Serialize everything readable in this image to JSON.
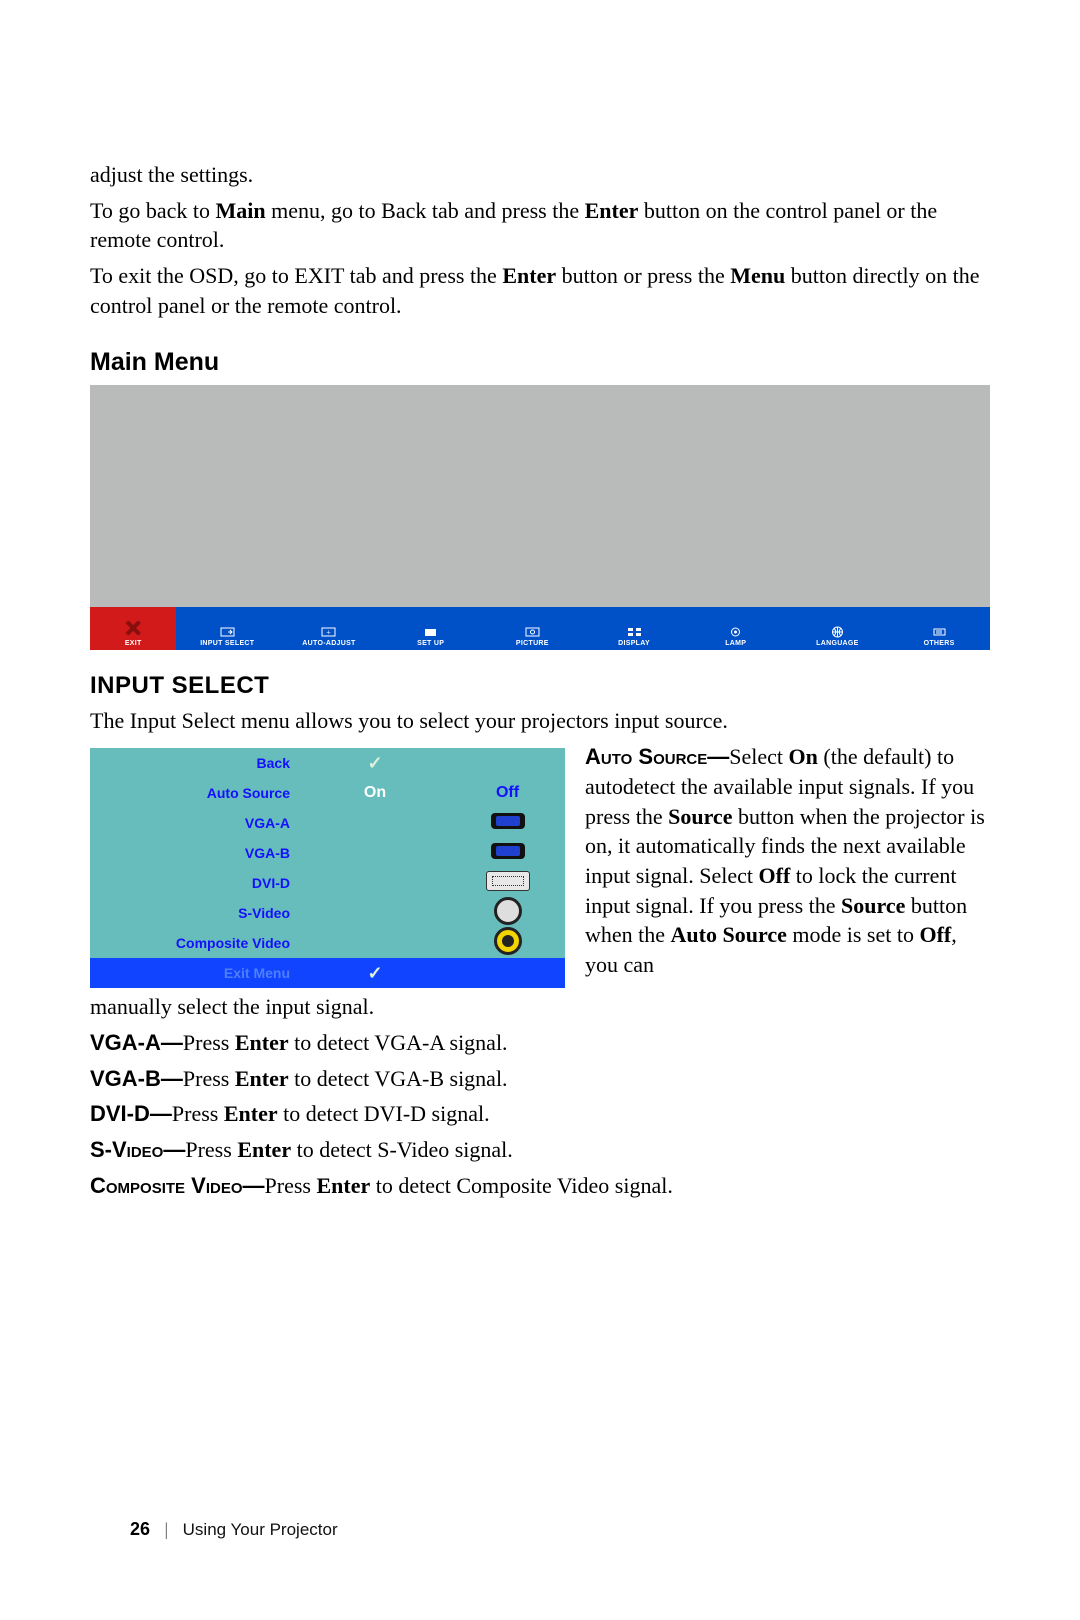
{
  "intro": {
    "p1": "adjust the settings.",
    "p2a": "To go back to ",
    "p2b": "Main",
    "p2c": " menu, go to Back tab and press the ",
    "p2d": "Enter",
    "p2e": " button on the control panel or the remote control.",
    "p3a": "To exit the OSD, go to EXIT tab and press the ",
    "p3b": "Enter",
    "p3c": " button or press the ",
    "p3d": "Menu",
    "p3e": " button directly on the control panel or the remote control."
  },
  "headings": {
    "main_menu": "Main Menu",
    "input_select": "INPUT SELECT"
  },
  "mainmenu_tabs": {
    "exit": "EXIT",
    "input_select": "INPUT SELECT",
    "auto_adjust": "AUTO-ADJUST",
    "set_up": "SET UP",
    "picture": "PICTURE",
    "display": "DISPLAY",
    "lamp": "LAMP",
    "language": "LANGUAGE",
    "others": "OTHERS"
  },
  "input_select_section": {
    "intro": "The Input Select menu allows you to select your projectors input source.",
    "menu": {
      "back": "Back",
      "auto_source": "Auto Source",
      "on": "On",
      "off": "Off",
      "vga_a": "VGA-A",
      "vga_b": "VGA-B",
      "dvi_d": "DVI-D",
      "s_video": "S-Video",
      "composite": "Composite Video",
      "exit_menu": "Exit Menu"
    },
    "auto_source_desc": {
      "label": "Auto Source—",
      "t1": "Select ",
      "b1": "On",
      "t2": " (the default) to autodetect the available input signals. If you press the ",
      "b2": "Source",
      "t3": " button when the projector is on, it automatically finds the next available input signal. Select ",
      "b3": "Off",
      "t4": " to lock the current input signal. If you press the ",
      "b4": "Source",
      "t5": " button when the ",
      "b5": "Auto Source",
      "t6": " mode is set to ",
      "b6": "Off",
      "t7": ", you can "
    },
    "manual": "manually select the input signal.",
    "lines": {
      "vga_a": {
        "label": "VGA-A—",
        "t1": "Press ",
        "b": "Enter",
        "t2": " to detect VGA-A signal."
      },
      "vga_b": {
        "label": "VGA-B—",
        "t1": "Press ",
        "b": "Enter",
        "t2": " to detect VGA-B signal."
      },
      "dvi_d": {
        "label": "DVI-D—",
        "t1": "Press ",
        "b": "Enter",
        "t2": " to detect DVI-D signal."
      },
      "s_video": {
        "label": "S-Video—",
        "t1": "Press ",
        "b": "Enter",
        "t2": " to detect S-Video signal."
      },
      "composite": {
        "label": "Composite Video—",
        "t1": "Press ",
        "b": "Enter",
        "t2": " to detect Composite Video signal."
      }
    }
  },
  "footer": {
    "page_number": "26",
    "section": "Using Your Projector"
  }
}
